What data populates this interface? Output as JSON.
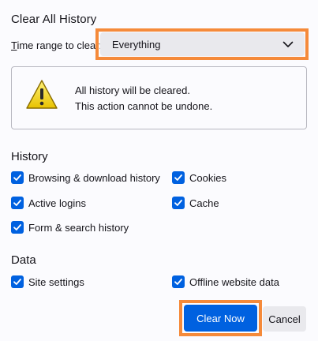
{
  "dialog": {
    "title": "Clear All History",
    "time_range": {
      "label_prefix": "",
      "label_underline": "T",
      "label_rest": "ime range to clear:",
      "selected": "Everything"
    },
    "warning": {
      "line1": "All history will be cleared.",
      "line2": "This action cannot be undone.",
      "icon": "warning-triangle-icon"
    },
    "history": {
      "title": "History",
      "items": [
        {
          "label": "Browsing & download history",
          "checked": true
        },
        {
          "label": "Cookies",
          "checked": true
        },
        {
          "label": "Active logins",
          "checked": true
        },
        {
          "label": "Cache",
          "checked": true
        },
        {
          "label": "Form & search history",
          "checked": true
        }
      ]
    },
    "data": {
      "title": "Data",
      "items": [
        {
          "label": "Site settings",
          "checked": true
        },
        {
          "label": "Offline website data",
          "checked": true
        }
      ]
    },
    "buttons": {
      "clear_now": "Clear Now",
      "cancel": "Cancel"
    },
    "colors": {
      "accent": "#0061e0",
      "highlight": "#f58a3a",
      "warning_yellow": "#f5d200"
    }
  }
}
